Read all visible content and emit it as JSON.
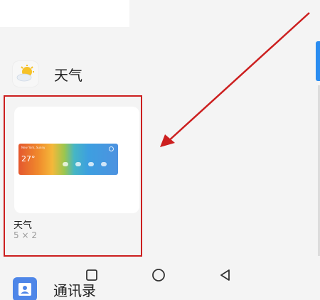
{
  "app": {
    "icon": "sun-cloud-icon",
    "name": "天气"
  },
  "widget_card": {
    "title": "天气",
    "size": "5 × 2",
    "preview": {
      "city_label": "New York, Sunny",
      "temperature": "27°"
    }
  },
  "navigation": {
    "recent_icon": "square-icon",
    "home_icon": "circle-icon",
    "back_icon": "triangle-icon"
  },
  "next_app": {
    "icon": "contacts-icon",
    "name": "通讯录"
  },
  "colors": {
    "highlight": "#cc1f1f",
    "accent": "#2a8cf0"
  }
}
